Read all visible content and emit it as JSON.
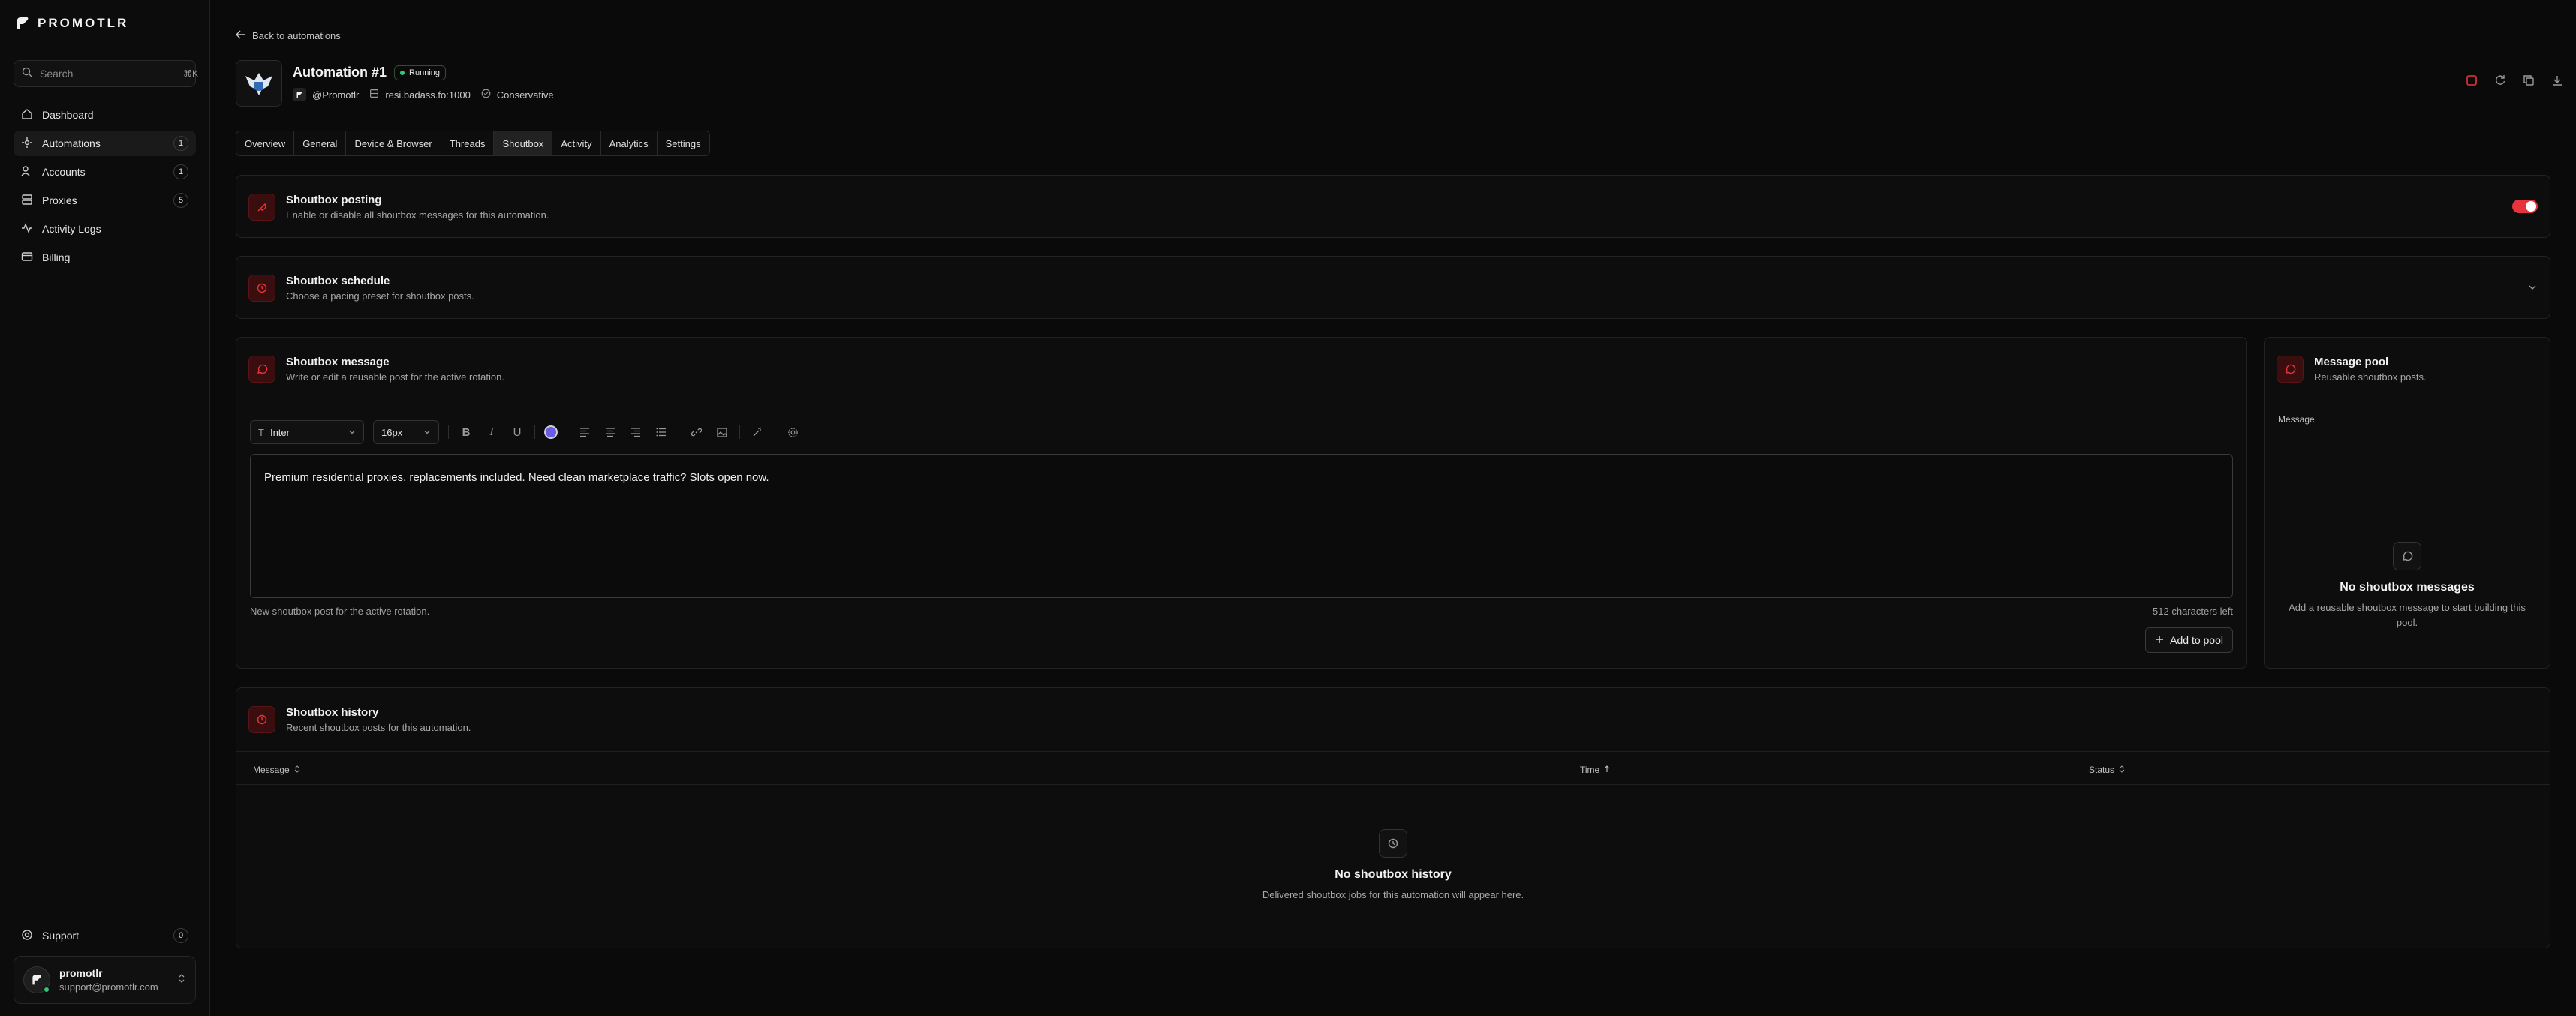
{
  "brand": {
    "name": "PROMOTLR"
  },
  "search": {
    "placeholder": "Search",
    "shortcut": "⌘K"
  },
  "nav": [
    {
      "label": "Dashboard",
      "icon": "home-icon",
      "badge": null
    },
    {
      "label": "Automations",
      "icon": "automations-icon",
      "badge": "1",
      "active": true
    },
    {
      "label": "Accounts",
      "icon": "users-icon",
      "badge": "1"
    },
    {
      "label": "Proxies",
      "icon": "server-icon",
      "badge": "5"
    },
    {
      "label": "Activity Logs",
      "icon": "activity-icon",
      "badge": null
    },
    {
      "label": "Billing",
      "icon": "credit-card-icon",
      "badge": null
    }
  ],
  "support": {
    "label": "Support",
    "badge": "0"
  },
  "user": {
    "name": "promotlr",
    "email": "support@promotlr.com"
  },
  "back_link": "Back to automations",
  "automation": {
    "title": "Automation #1",
    "status": "Running",
    "account": "@Promotlr",
    "proxy": "resi.badass.fo:1000",
    "mode": "Conservative"
  },
  "tabs": [
    "Overview",
    "General",
    "Device & Browser",
    "Threads",
    "Shoutbox",
    "Activity",
    "Analytics",
    "Settings"
  ],
  "active_tab": "Shoutbox",
  "posting": {
    "title": "Shoutbox posting",
    "subtitle": "Enable or disable all shoutbox messages for this automation.",
    "enabled": true
  },
  "schedule": {
    "title": "Shoutbox schedule",
    "subtitle": "Choose a pacing preset for shoutbox posts."
  },
  "message": {
    "title": "Shoutbox message",
    "subtitle": "Write or edit a reusable post for the active rotation.",
    "font": "Inter",
    "size": "16px",
    "text_color": "#6b5ce7",
    "body": "Premium residential proxies, replacements included. Need clean marketplace traffic? Slots open now.",
    "helper": "New shoutbox post for the active rotation.",
    "chars_left": "512 characters left",
    "add_button": "Add to pool"
  },
  "pool": {
    "title": "Message pool",
    "subtitle": "Reusable shoutbox posts.",
    "column": "Message",
    "empty_title": "No shoutbox messages",
    "empty_sub": "Add a reusable shoutbox message to start building this pool."
  },
  "history": {
    "title": "Shoutbox history",
    "subtitle": "Recent shoutbox posts for this automation.",
    "columns": [
      "Message",
      "Time",
      "Status"
    ],
    "empty_title": "No shoutbox history",
    "empty_sub": "Delivered shoutbox jobs for this automation will appear here."
  },
  "colors": {
    "accent": "#e5343b",
    "status_dot": "#2ecc71"
  }
}
